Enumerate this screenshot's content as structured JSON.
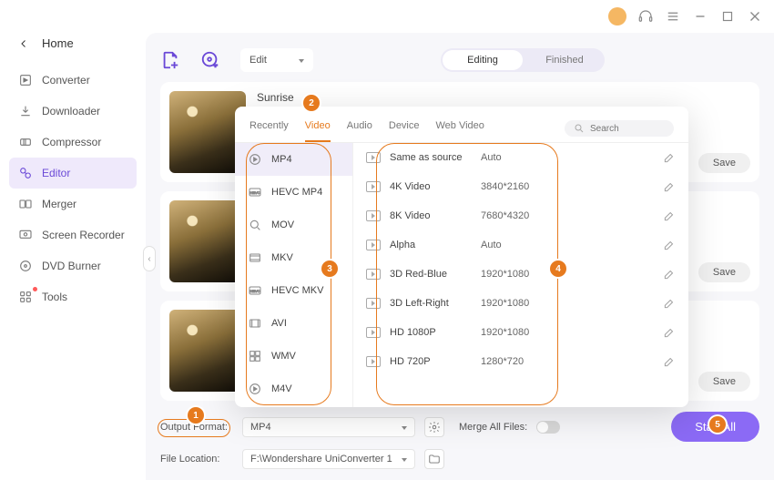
{
  "titlebar": {
    "user_initial": ""
  },
  "sidebar": {
    "back_label": "Home",
    "items": [
      {
        "label": "Converter",
        "icon": "converter-icon"
      },
      {
        "label": "Downloader",
        "icon": "downloader-icon"
      },
      {
        "label": "Compressor",
        "icon": "compressor-icon"
      },
      {
        "label": "Editor",
        "icon": "editor-icon",
        "active": true
      },
      {
        "label": "Merger",
        "icon": "merger-icon"
      },
      {
        "label": "Screen Recorder",
        "icon": "recorder-icon"
      },
      {
        "label": "DVD Burner",
        "icon": "dvd-icon"
      },
      {
        "label": "Tools",
        "icon": "tools-icon",
        "hasdot": true
      }
    ]
  },
  "toolbar": {
    "mode_label": "Edit",
    "pill_editing": "Editing",
    "pill_finished": "Finished"
  },
  "card": {
    "title": "Sunrise",
    "save_label": "Save"
  },
  "popup": {
    "tabs": [
      "Recently",
      "Video",
      "Audio",
      "Device",
      "Web Video"
    ],
    "active_tab": "Video",
    "search_placeholder": "Search",
    "formats": [
      "MP4",
      "HEVC MP4",
      "MOV",
      "MKV",
      "HEVC MKV",
      "AVI",
      "WMV",
      "M4V"
    ],
    "resolutions": [
      {
        "name": "Same as source",
        "value": "Auto"
      },
      {
        "name": "4K Video",
        "value": "3840*2160"
      },
      {
        "name": "8K Video",
        "value": "7680*4320"
      },
      {
        "name": "Alpha",
        "value": "Auto"
      },
      {
        "name": "3D Red-Blue",
        "value": "1920*1080"
      },
      {
        "name": "3D Left-Right",
        "value": "1920*1080"
      },
      {
        "name": "HD 1080P",
        "value": "1920*1080"
      },
      {
        "name": "HD 720P",
        "value": "1280*720"
      }
    ]
  },
  "footer": {
    "output_format_label": "Output Format:",
    "output_format_value": "MP4",
    "file_location_label": "File Location:",
    "file_location_value": "F:\\Wondershare UniConverter 1",
    "merge_label": "Merge All Files:",
    "start_all": "Start All"
  },
  "badges": {
    "1": "1",
    "2": "2",
    "3": "3",
    "4": "4",
    "5": "5"
  }
}
